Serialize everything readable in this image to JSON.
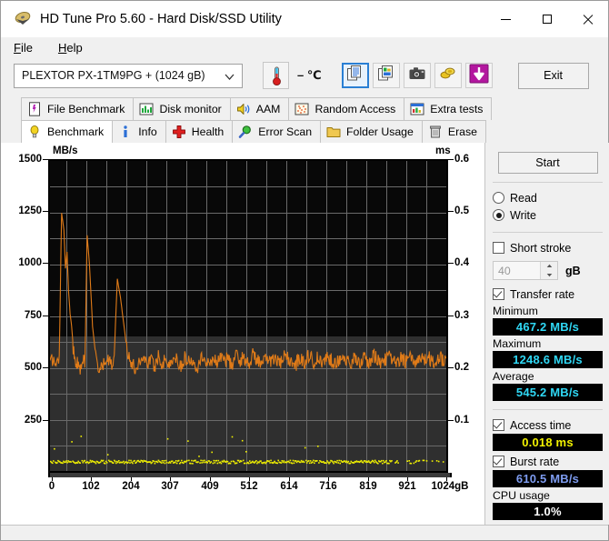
{
  "window": {
    "title": "HD Tune Pro 5.60 - Hard Disk/SSD Utility",
    "app_icon": "hdtune-logo-icon",
    "minimize": "minimize-icon",
    "maximize": "maximize-icon",
    "close": "close-icon"
  },
  "menu": {
    "items": [
      {
        "label": "File",
        "accel": "F"
      },
      {
        "label": "Help",
        "accel": "H"
      }
    ]
  },
  "toolbar": {
    "drive": "PLEXTOR PX-1TM9PG + (1024 gB)",
    "temperature": "– ℃",
    "buttons": [
      {
        "name": "copy-text-button",
        "icon": "copy-document-icon",
        "selected": true
      },
      {
        "name": "copy-image-button",
        "icon": "copy-image-icon",
        "selected": false
      },
      {
        "name": "screenshot-button",
        "icon": "camera-icon",
        "selected": false
      },
      {
        "name": "coins-button",
        "icon": "gold-coins-icon",
        "selected": false
      },
      {
        "name": "download-button",
        "icon": "down-arrow-icon",
        "selected": false
      }
    ],
    "exit_label": "Exit"
  },
  "tabs": {
    "row1": [
      {
        "label": "File Benchmark",
        "icon": "file-benchmark-icon",
        "active": false
      },
      {
        "label": "Disk monitor",
        "icon": "bar-chart-icon",
        "active": false
      },
      {
        "label": "AAM",
        "icon": "speaker-icon",
        "active": false
      },
      {
        "label": "Random Access",
        "icon": "scatter-icon",
        "active": false
      },
      {
        "label": "Extra tests",
        "icon": "extra-tests-icon",
        "active": false
      }
    ],
    "row2": [
      {
        "label": "Benchmark",
        "icon": "bulb-icon",
        "active": true
      },
      {
        "label": "Info",
        "icon": "info-icon",
        "active": false
      },
      {
        "label": "Health",
        "icon": "red-cross-icon",
        "active": false
      },
      {
        "label": "Error Scan",
        "icon": "magnifier-icon",
        "active": false
      },
      {
        "label": "Folder Usage",
        "icon": "folder-icon",
        "active": false
      },
      {
        "label": "Erase",
        "icon": "trash-icon",
        "active": false
      }
    ]
  },
  "panel": {
    "start_label": "Start",
    "mode": {
      "read_label": "Read",
      "write_label": "Write",
      "selected": "Write"
    },
    "short_stroke": {
      "label": "Short stroke",
      "checked": false,
      "value": "40",
      "unit": "gB"
    },
    "transfer_rate": {
      "label": "Transfer rate",
      "checked": true
    },
    "minimum": {
      "label": "Minimum",
      "value": "467.2 MB/s"
    },
    "maximum": {
      "label": "Maximum",
      "value": "1248.6 MB/s"
    },
    "average": {
      "label": "Average",
      "value": "545.2 MB/s"
    },
    "access_time": {
      "label": "Access time",
      "checked": true,
      "value": "0.018 ms"
    },
    "burst_rate": {
      "label": "Burst rate",
      "checked": true,
      "value": "610.5 MB/s"
    },
    "cpu_usage": {
      "label": "CPU usage",
      "value": "1.0%"
    }
  },
  "colors": {
    "transfer_rate_line": "#e07b18",
    "access_time_dots": "#f2f200",
    "value_cyan": "#2fd8f5",
    "value_yellow": "#f2f200",
    "value_blue": "#7e9cf0",
    "plot_background_top": "#080808",
    "plot_background_bottom": "#2f2f2f",
    "gridlines": "#6a6a6a"
  },
  "chart_data": {
    "type": "line",
    "title": "",
    "left_axis_label": "MB/s",
    "right_axis_label": "ms",
    "xlabel": "gB",
    "ylabel": "MB/s",
    "ylim": [
      0,
      1500
    ],
    "y2lim": [
      0,
      0.6
    ],
    "xlim": [
      0,
      1024
    ],
    "yticks": [
      250,
      500,
      750,
      1000,
      1250,
      1500
    ],
    "y2ticks": [
      0.1,
      0.2,
      0.3,
      0.4,
      0.5,
      0.6
    ],
    "xticks": [
      0,
      102,
      204,
      307,
      409,
      512,
      614,
      716,
      819,
      921,
      1024
    ],
    "xtick_labels": [
      "0",
      "102",
      "204",
      "307",
      "409",
      "512",
      "614",
      "716",
      "819",
      "921",
      "1024gB"
    ],
    "grid": true,
    "legend": "none",
    "series": [
      {
        "name": "Transfer rate",
        "color": "#e07b18",
        "axis": "left",
        "units": "MB/s",
        "x": [
          0,
          8,
          16,
          24,
          30,
          36,
          40,
          44,
          48,
          52,
          56,
          60,
          64,
          68,
          72,
          78,
          84,
          90,
          96,
          102,
          110,
          118,
          126,
          134,
          142,
          150,
          158,
          166,
          174,
          182,
          190,
          198,
          206,
          214,
          222,
          230,
          240,
          250,
          260,
          270,
          280,
          290,
          300,
          310,
          320,
          330,
          340,
          350,
          360,
          370,
          380,
          390,
          400,
          410,
          420,
          430,
          440,
          450,
          460,
          470,
          480,
          490,
          500,
          512,
          524,
          536,
          548,
          560,
          572,
          584,
          596,
          608,
          620,
          632,
          644,
          656,
          668,
          680,
          692,
          704,
          716,
          728,
          740,
          752,
          764,
          776,
          788,
          800,
          812,
          824,
          836,
          848,
          860,
          872,
          884,
          896,
          908,
          920,
          932,
          944,
          956,
          968,
          980,
          992,
          1004,
          1016,
          1024
        ],
        "y": [
          520,
          545,
          505,
          560,
          1248,
          1165,
          980,
          1060,
          870,
          760,
          700,
          600,
          540,
          530,
          515,
          490,
          560,
          500,
          1140,
          1000,
          700,
          560,
          480,
          500,
          520,
          540,
          510,
          560,
          930,
          840,
          720,
          600,
          540,
          510,
          490,
          530,
          555,
          520,
          545,
          500,
          560,
          520,
          545,
          505,
          560,
          530,
          510,
          550,
          525,
          545,
          500,
          560,
          530,
          515,
          550,
          525,
          560,
          530,
          545,
          510,
          560,
          535,
          550,
          520,
          560,
          540,
          505,
          555,
          530,
          545,
          515,
          560,
          535,
          500,
          550,
          525,
          560,
          530,
          545,
          510,
          555,
          535,
          520,
          560,
          540,
          505,
          550,
          530,
          545,
          515,
          560,
          535,
          525,
          555,
          540,
          510,
          550,
          530,
          545,
          520,
          560,
          535,
          545,
          515,
          550,
          540,
          545
        ]
      },
      {
        "name": "Access time",
        "color": "#f2f200",
        "axis": "right",
        "units": "ms",
        "average": 0.018,
        "description": "Dense scatter of access-time samples clustered just above zero (~0.018 ms) across the full 0-1024 gB span, with a few outliers up to ~0.10 ms."
      }
    ]
  }
}
